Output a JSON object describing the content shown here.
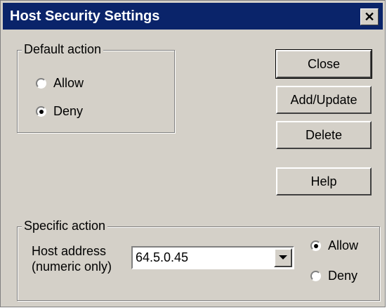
{
  "window": {
    "title": "Host Security Settings",
    "close_glyph": "✕"
  },
  "default_action": {
    "label": "Default action",
    "options": [
      {
        "label": "Allow",
        "selected": false
      },
      {
        "label": "Deny",
        "selected": true
      }
    ]
  },
  "buttons": {
    "close": "Close",
    "add_update": "Add/Update",
    "delete": "Delete",
    "help": "Help"
  },
  "specific_action": {
    "label": "Specific action",
    "host_label_line1": "Host address",
    "host_label_line2": "(numeric only)",
    "host_value": "64.5.0.45",
    "options": [
      {
        "label": "Allow",
        "selected": true
      },
      {
        "label": "Deny",
        "selected": false
      }
    ]
  }
}
